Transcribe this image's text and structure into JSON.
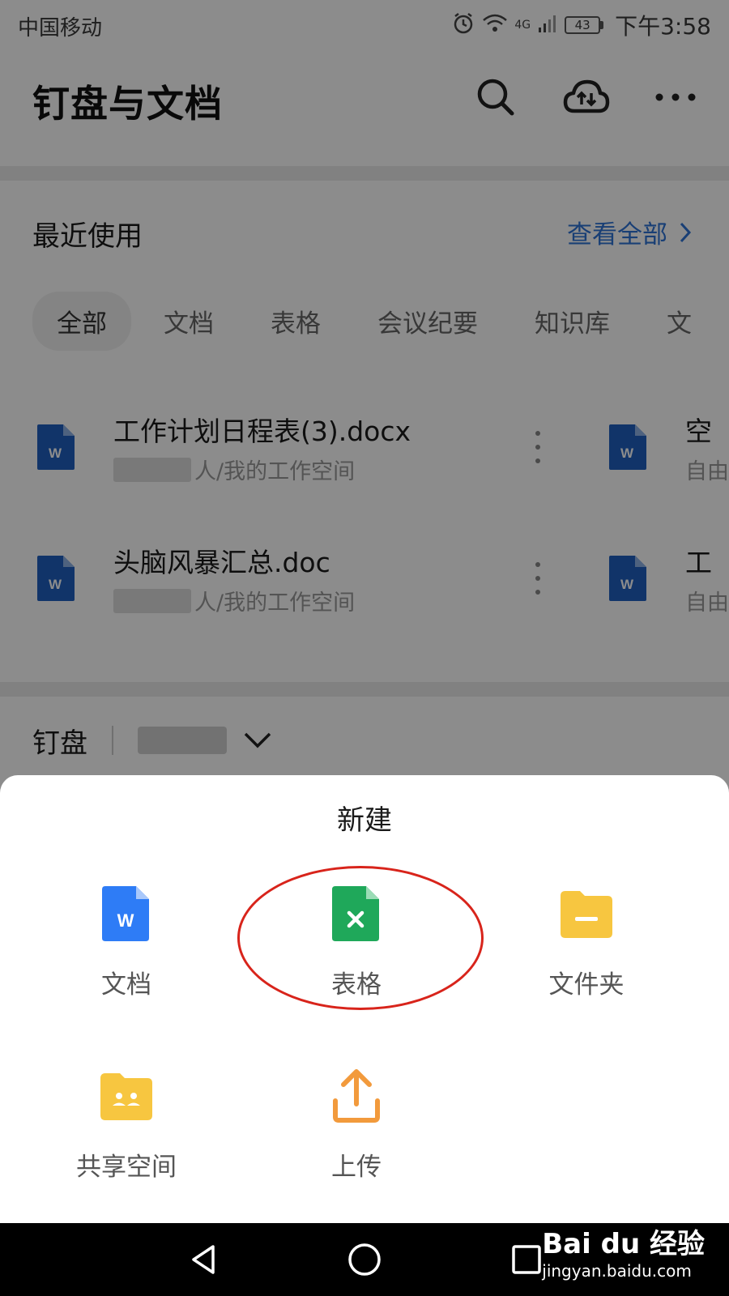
{
  "status_bar": {
    "carrier": "中国移动",
    "network": "4G",
    "battery": "43",
    "time": "下午3:58"
  },
  "app_bar": {
    "title": "钉盘与文档",
    "icons": [
      "search-icon",
      "cloud-sync-icon",
      "more-icon"
    ]
  },
  "recent": {
    "title": "最近使用",
    "view_all": "查看全部",
    "tabs": [
      {
        "label": "全部",
        "active": true
      },
      {
        "label": "文档",
        "active": false
      },
      {
        "label": "表格",
        "active": false
      },
      {
        "label": "会议纪要",
        "active": false
      },
      {
        "label": "知识库",
        "active": false
      },
      {
        "label": "文",
        "active": false
      }
    ],
    "files": [
      {
        "name": "工作计划日程表(3).docx",
        "path": "人/我的工作空间",
        "icon": "word-doc-icon"
      },
      {
        "name": "头脑风暴汇总.doc",
        "path": "人/我的工作空间",
        "icon": "word-doc-icon"
      }
    ],
    "files_right": [
      {
        "name": "空",
        "path": "自由"
      },
      {
        "name": "工",
        "path": "自由"
      }
    ]
  },
  "drive": {
    "title": "钉盘"
  },
  "new_sheet": {
    "title": "新建",
    "options": [
      {
        "label": "文档",
        "icon": "word-doc-icon",
        "color": "#2e7cf6"
      },
      {
        "label": "表格",
        "icon": "sheet-icon",
        "color": "#1fa85a"
      },
      {
        "label": "文件夹",
        "icon": "folder-icon",
        "color": "#f7c640"
      },
      {
        "label": "共享空间",
        "icon": "shared-folder-icon",
        "color": "#f7c640"
      },
      {
        "label": "上传",
        "icon": "upload-icon",
        "color": "#f29a3c"
      }
    ]
  },
  "watermark": {
    "logo": "Bai du 经验",
    "url": "jingyan.baidu.com"
  },
  "colors": {
    "accent": "#2e73d6",
    "highlight": "#d8241b"
  }
}
